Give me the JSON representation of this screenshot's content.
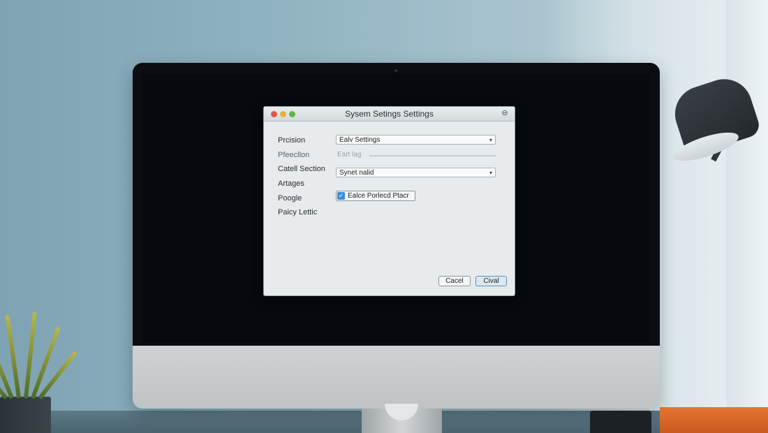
{
  "dialog": {
    "title": "Sysem Setings Settings",
    "help_glyph": "⊖",
    "rows": [
      {
        "label": "Prcision"
      },
      {
        "label": "Pfeecllon"
      },
      {
        "label": "Catell Section"
      },
      {
        "label": "Artages"
      },
      {
        "label": "Poogle"
      },
      {
        "label": "Paicy Lettic"
      }
    ],
    "select_1": {
      "value": "Ealv Settings"
    },
    "slider_field": {
      "placeholder": "Eart lag"
    },
    "select_2": {
      "value": "Synet nalid"
    },
    "checkbox": {
      "label": "Ealce Porlecd Ptacr",
      "checked": true,
      "check_glyph": "✓"
    },
    "buttons": {
      "cancel": "Cacel",
      "ok": "Cival"
    },
    "select_arrow": "▾"
  }
}
